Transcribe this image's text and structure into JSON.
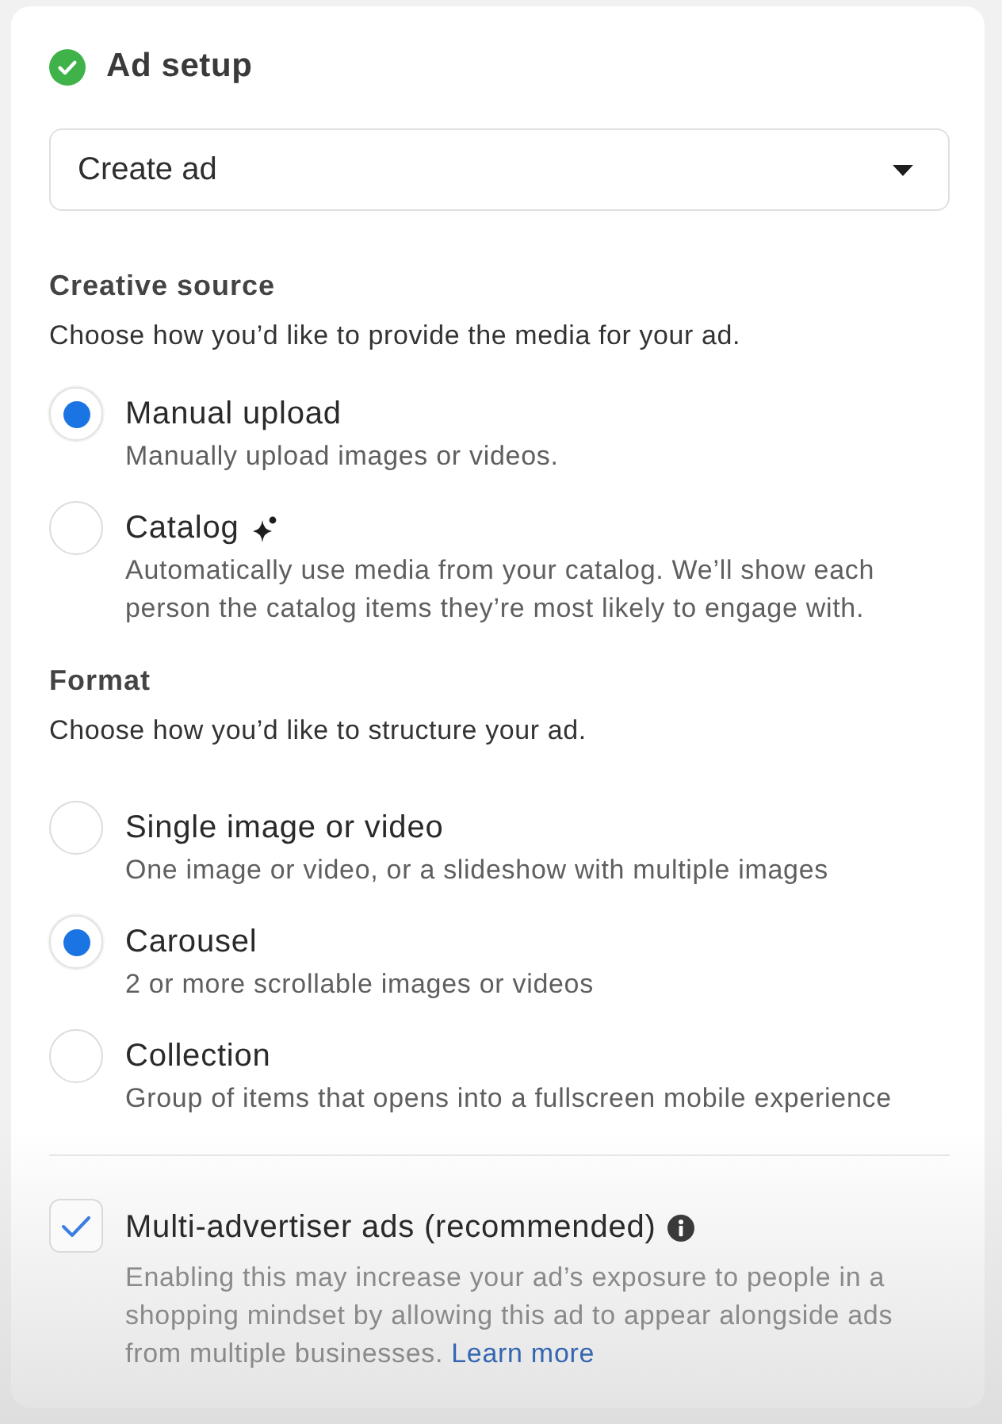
{
  "header": {
    "title": "Ad setup",
    "complete": true
  },
  "ad_type_dropdown": {
    "value": "Create ad"
  },
  "creative_source": {
    "title": "Creative source",
    "description": "Choose how you’d like to provide the media for your ad.",
    "options": [
      {
        "label": "Manual upload",
        "description": "Manually upload images or videos.",
        "selected": true
      },
      {
        "label": "Catalog",
        "trailing_icon": true,
        "description": "Automatically use media from your catalog. We’ll show each person the catalog items they’re most likely to engage with.",
        "selected": false
      }
    ]
  },
  "format": {
    "title": "Format",
    "description": "Choose how you’d like to structure your ad.",
    "options": [
      {
        "label": "Single image or video",
        "description": "One image or video, or a slideshow with multiple images",
        "selected": false
      },
      {
        "label": "Carousel",
        "description": "2 or more scrollable images or videos",
        "selected": true
      },
      {
        "label": "Collection",
        "description": "Group of items that opens into a fullscreen mobile experience",
        "selected": false
      }
    ]
  },
  "multi_advertiser": {
    "label": "Multi-advertiser ads (recommended)",
    "info": true,
    "checked": true,
    "description": "Enabling this may increase your ad’s exposure to people in a shopping mindset by allowing this ad to appear alongside ads from multiple businesses.",
    "link": "Learn more"
  }
}
